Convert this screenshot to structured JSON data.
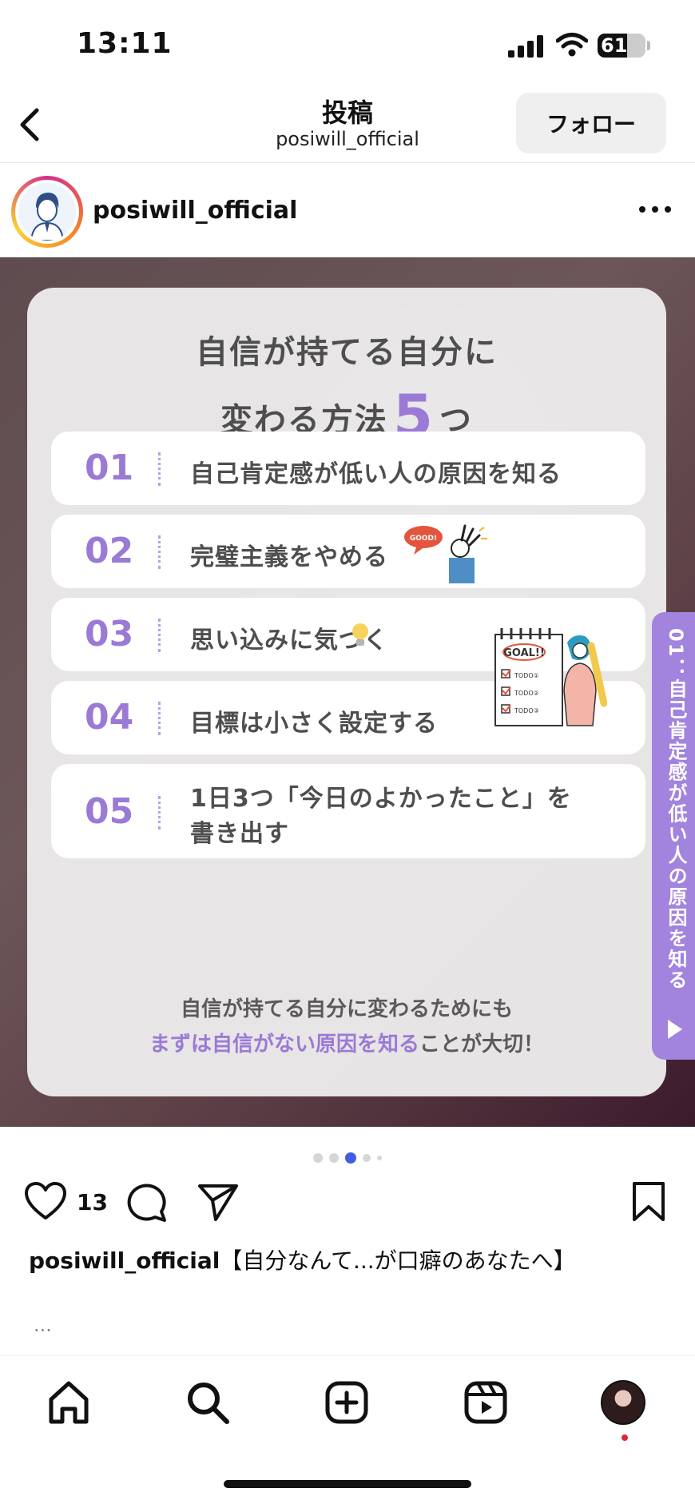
{
  "status_bar": {
    "time": "13:11",
    "battery": "61",
    "battery_level": 0.61
  },
  "header": {
    "title": "投稿",
    "subtitle": "posiwill_official",
    "follow_label": "フォロー"
  },
  "post": {
    "username": "posiwill_official",
    "card": {
      "title_line1": "自信が持てる自分に",
      "title_line2_before": "変わる方法",
      "title_number": "5",
      "title_line2_after": "つ",
      "items": [
        {
          "num": "01",
          "text": "自己肯定感が低い人の原因を知る"
        },
        {
          "num": "02",
          "text": "完璧主義をやめる",
          "sticker": "GOOD!"
        },
        {
          "num": "03",
          "text": "思い込みに気づく"
        },
        {
          "num": "04",
          "text": "目標は小さく設定する"
        },
        {
          "num": "05",
          "text_line1": "1日3つ「今日のよかったこと」を",
          "text_line2": "書き出す"
        }
      ],
      "goal_sticker": {
        "title": "GOAL!!",
        "todos": [
          "TODO①",
          "TODO②",
          "TODO③"
        ]
      },
      "footer_line1": "自信が持てる自分に変わるためにも",
      "footer_highlight": "まずは自信がない原因を知る",
      "footer_rest": "ことが大切！"
    },
    "side_tab_label": "01：自己肯定感が低い人の原因を知る",
    "carousel": {
      "count": 5,
      "active": 3
    },
    "like_count": "13",
    "caption_user": "posiwill_official",
    "caption_text": "【自分なんて...が口癖のあなたへ】",
    "caption_more": "..."
  },
  "colors": {
    "accent_purple": "#9b7ad6",
    "side_tab": "#a283de",
    "active_dot": "#3f5fe0"
  },
  "icons": {
    "back": "chevron-left-icon",
    "more": "more-horizontal-icon",
    "like": "heart-icon",
    "comment": "comment-bubble-icon",
    "share": "paper-plane-icon",
    "save": "bookmark-icon",
    "home": "home-icon",
    "search": "search-icon",
    "create": "plus-square-icon",
    "reels": "reels-icon",
    "profile": "profile-avatar"
  }
}
